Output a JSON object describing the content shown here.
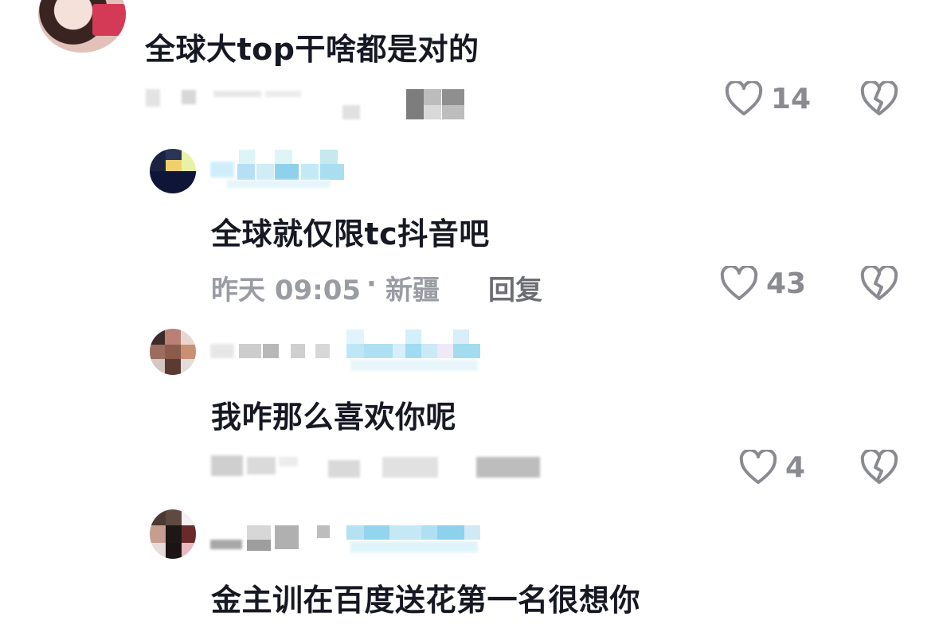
{
  "comments": [
    {
      "text": "全球大top干啥都是对的",
      "likes": "14"
    },
    {
      "text": "全球就仅限tc抖音吧",
      "time": "昨天 09:05",
      "sep": "·",
      "location": "新疆",
      "reply": "回复",
      "likes": "43"
    },
    {
      "text": "我咋那么喜欢你呢",
      "likes": "4"
    },
    {
      "text": "金主训在百度送花第一名很想你"
    }
  ],
  "icons": {
    "like": "heart-outline-icon",
    "dislike": "broken-heart-icon"
  },
  "colors": {
    "text": "#161823",
    "meta": "#9a9ca3",
    "icon": "#8a8b91"
  }
}
